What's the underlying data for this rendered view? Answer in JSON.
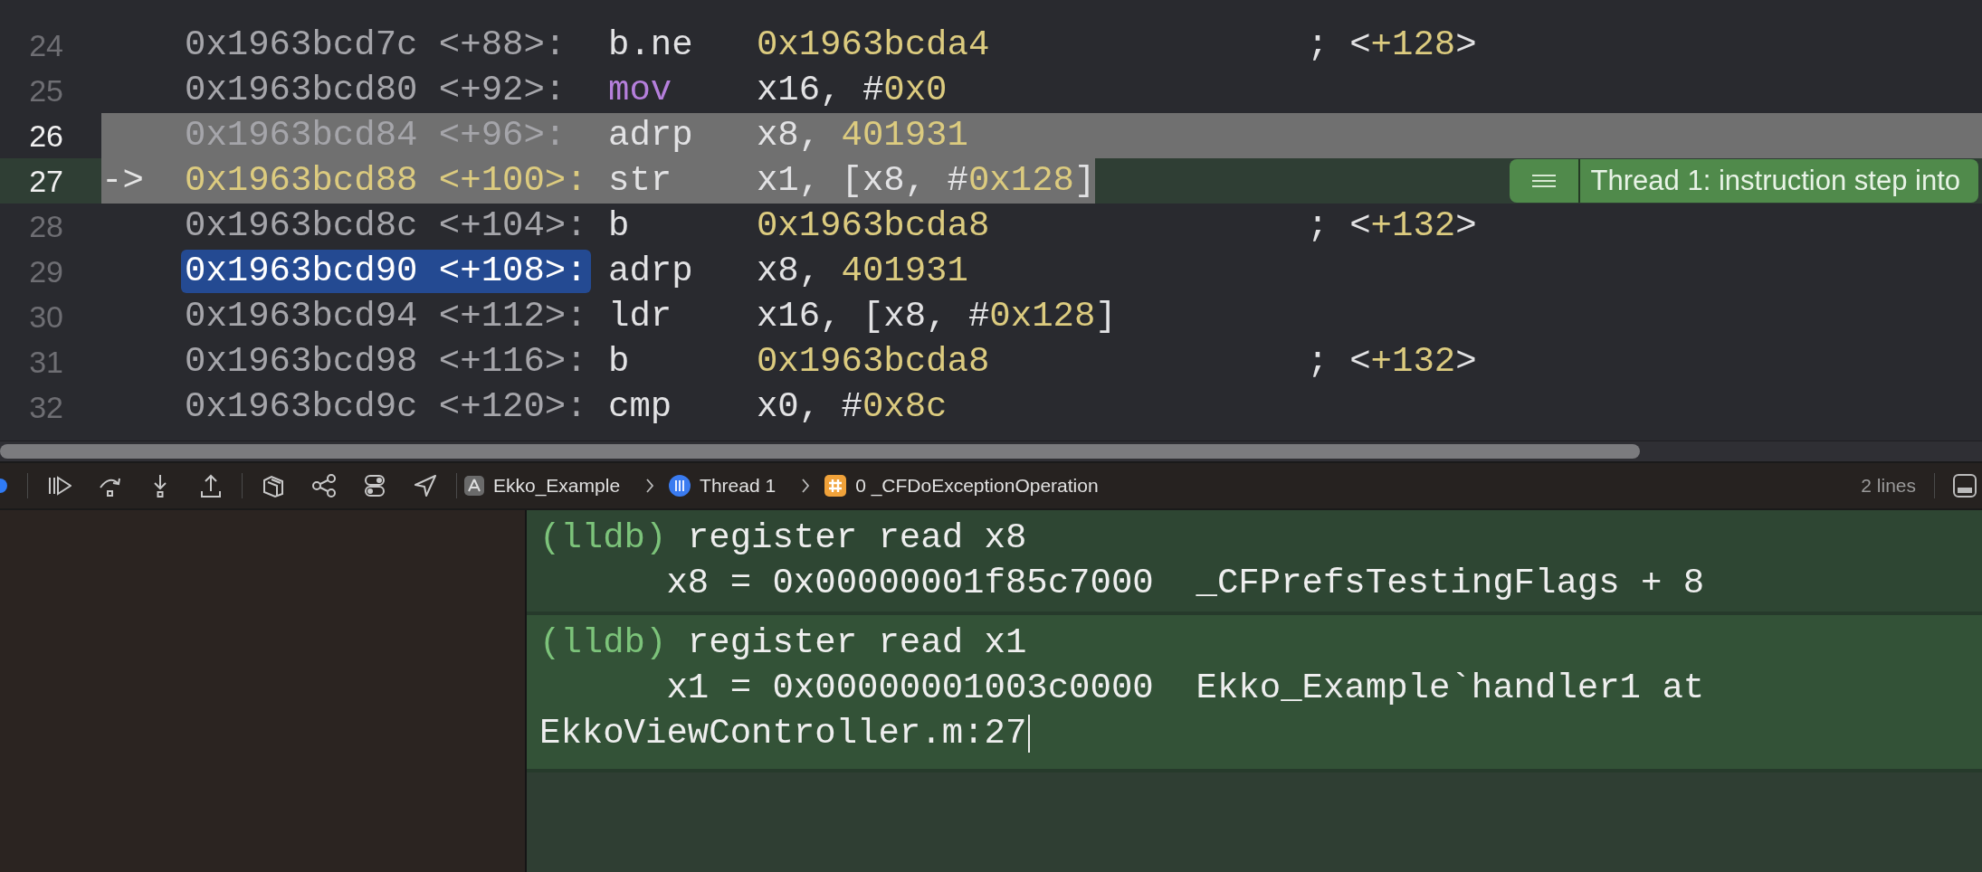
{
  "code_lines": [
    {
      "line": "24",
      "address": "0x1963bcd7c",
      "offset": "<+88>:",
      "mnemonic": {
        "text": "b.ne",
        "kind": "plain"
      },
      "operands": [
        {
          "text": "0x1963bcda4",
          "kind": "number"
        }
      ],
      "comment": [
        {
          "text": "; <",
          "kind": "plain"
        },
        {
          "text": "+128",
          "kind": "number"
        },
        {
          "text": ">",
          "kind": "plain"
        }
      ],
      "highlighted": false,
      "current": false,
      "selected": false
    },
    {
      "line": "25",
      "address": "0x1963bcd80",
      "offset": "<+92>:",
      "mnemonic": {
        "text": "mov",
        "kind": "keyword"
      },
      "operands": [
        {
          "text": "x16, #",
          "kind": "plain"
        },
        {
          "text": "0x0",
          "kind": "number"
        }
      ],
      "highlighted": false,
      "current": false,
      "selected": false
    },
    {
      "line": "26",
      "address": "0x1963bcd84",
      "offset": "<+96>:",
      "mnemonic": {
        "text": "adrp",
        "kind": "plain"
      },
      "operands": [
        {
          "text": "x8, ",
          "kind": "plain"
        },
        {
          "text": "401931",
          "kind": "number"
        }
      ],
      "highlighted": true,
      "current": false,
      "selected": false
    },
    {
      "line": "27",
      "marker": "->",
      "address": "0x1963bcd88",
      "offset": "<+100>:",
      "mnemonic": {
        "text": "str",
        "kind": "plain"
      },
      "operands": [
        {
          "text": "x1, [x8, #",
          "kind": "plain"
        },
        {
          "text": "0x128",
          "kind": "number"
        },
        {
          "text": "]",
          "kind": "plain"
        }
      ],
      "highlighted": true,
      "current": true,
      "selected": false,
      "annotation": "Thread 1: instruction step into"
    },
    {
      "line": "28",
      "address": "0x1963bcd8c",
      "offset": "<+104>:",
      "mnemonic": {
        "text": "b",
        "kind": "plain"
      },
      "operands": [
        {
          "text": "0x1963bcda8",
          "kind": "number"
        }
      ],
      "comment": [
        {
          "text": "; <",
          "kind": "plain"
        },
        {
          "text": "+132",
          "kind": "number"
        },
        {
          "text": ">",
          "kind": "plain"
        }
      ],
      "highlighted": false,
      "current": false,
      "selected": false
    },
    {
      "line": "29",
      "address": "0x1963bcd90",
      "offset": "<+108>:",
      "mnemonic": {
        "text": "adrp",
        "kind": "plain"
      },
      "operands": [
        {
          "text": "x8, ",
          "kind": "plain"
        },
        {
          "text": "401931",
          "kind": "number"
        }
      ],
      "highlighted": false,
      "current": false,
      "selected": true
    },
    {
      "line": "30",
      "address": "0x1963bcd94",
      "offset": "<+112>:",
      "mnemonic": {
        "text": "ldr",
        "kind": "plain"
      },
      "operands": [
        {
          "text": "x16, [x8, #",
          "kind": "plain"
        },
        {
          "text": "0x128",
          "kind": "number"
        },
        {
          "text": "]",
          "kind": "plain"
        }
      ],
      "highlighted": false,
      "current": false,
      "selected": false
    },
    {
      "line": "31",
      "address": "0x1963bcd98",
      "offset": "<+116>:",
      "mnemonic": {
        "text": "b",
        "kind": "plain"
      },
      "operands": [
        {
          "text": "0x1963bcda8",
          "kind": "number"
        }
      ],
      "comment": [
        {
          "text": "; <",
          "kind": "plain"
        },
        {
          "text": "+132",
          "kind": "number"
        },
        {
          "text": ">",
          "kind": "plain"
        }
      ],
      "highlighted": false,
      "current": false,
      "selected": false
    },
    {
      "line": "32",
      "address": "0x1963bcd9c",
      "offset": "<+120>:",
      "mnemonic": {
        "text": "cmp",
        "kind": "plain"
      },
      "operands": [
        {
          "text": "x0, #",
          "kind": "plain"
        },
        {
          "text": "0x8c",
          "kind": "number"
        }
      ],
      "highlighted": false,
      "current": false,
      "selected": false
    }
  ],
  "debug_bar": {
    "breadcrumbs": [
      {
        "kind": "app",
        "label": "Ekko_Example"
      },
      {
        "kind": "thread",
        "label": "Thread 1"
      },
      {
        "kind": "frame",
        "label": "0 _CFDoExceptionOperation"
      }
    ],
    "line_count": "2 lines"
  },
  "console": {
    "entries": [
      {
        "prompt": "(lldb)",
        "command": "register read x8",
        "output": [
          "x8 = 0x00000001f85c7000  _CFPrefsTestingFlags + 8"
        ],
        "active": false
      },
      {
        "prompt": "(lldb)",
        "command": "register read x1",
        "output": [
          "x1 = 0x00000001003c0000  Ekko_Example`handler1 at",
          "EkkoViewController.m:27"
        ],
        "active": true
      }
    ]
  }
}
